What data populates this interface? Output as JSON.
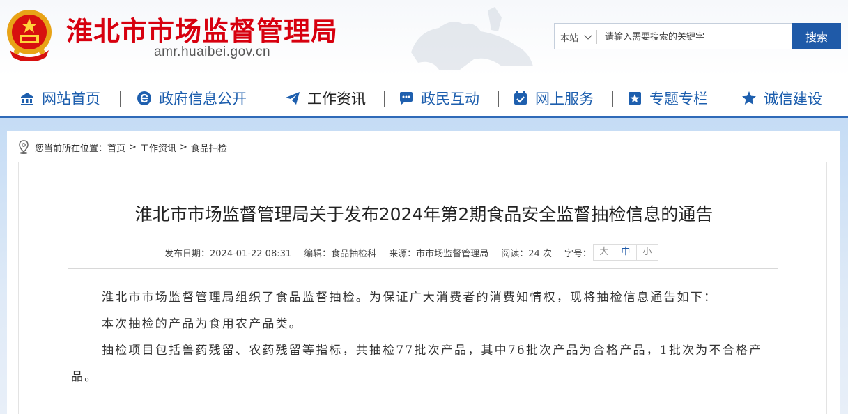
{
  "header": {
    "site_title": "淮北市市场监督管理局",
    "site_domain": "amr.huaibei.gov.cn",
    "search": {
      "scope": "本站",
      "placeholder": "请输入需要搜索的关键字",
      "button": "搜索"
    }
  },
  "nav": [
    {
      "label": "网站首页",
      "icon": "home-icon"
    },
    {
      "label": "政府信息公开",
      "icon": "e-gov-icon"
    },
    {
      "label": "工作资讯",
      "icon": "paper-plane-icon",
      "active": true
    },
    {
      "label": "政民互动",
      "icon": "chat-icon"
    },
    {
      "label": "网上服务",
      "icon": "calendar-check-icon"
    },
    {
      "label": "专题专栏",
      "icon": "star-box-icon"
    },
    {
      "label": "诚信建设",
      "icon": "star-icon"
    }
  ],
  "breadcrumb": {
    "prefix": "您当前所在位置：",
    "items": [
      "首页",
      "工作资讯",
      "食品抽检"
    ],
    "sep": ">"
  },
  "article": {
    "title": "淮北市市场监督管理局关于发布2024年第2期食品安全监督抽检信息的通告",
    "meta": {
      "date": "发布日期：2024-01-22 08:31",
      "editor": "编辑：食品抽检科",
      "source": "来源：市市场监督管理局",
      "views": "阅读：24 次",
      "fontsize_label": "字号：",
      "sizes": [
        "大",
        "中",
        "小"
      ]
    },
    "paragraphs": [
      "淮北市市场监督管理局组织了食品监督抽检。为保证广大消费者的消费知情权，现将抽检信息通告如下：",
      "本次抽检的产品为食用农产品类。",
      "抽检项目包括兽药残留、农药残留等指标，共抽检77批次产品，其中76批次产品为合格产品，1批次为不合格产品。"
    ]
  },
  "colors": {
    "brand_red": "#d7000f",
    "nav_blue": "#1e5fae",
    "button_blue": "#1f5aa8"
  }
}
